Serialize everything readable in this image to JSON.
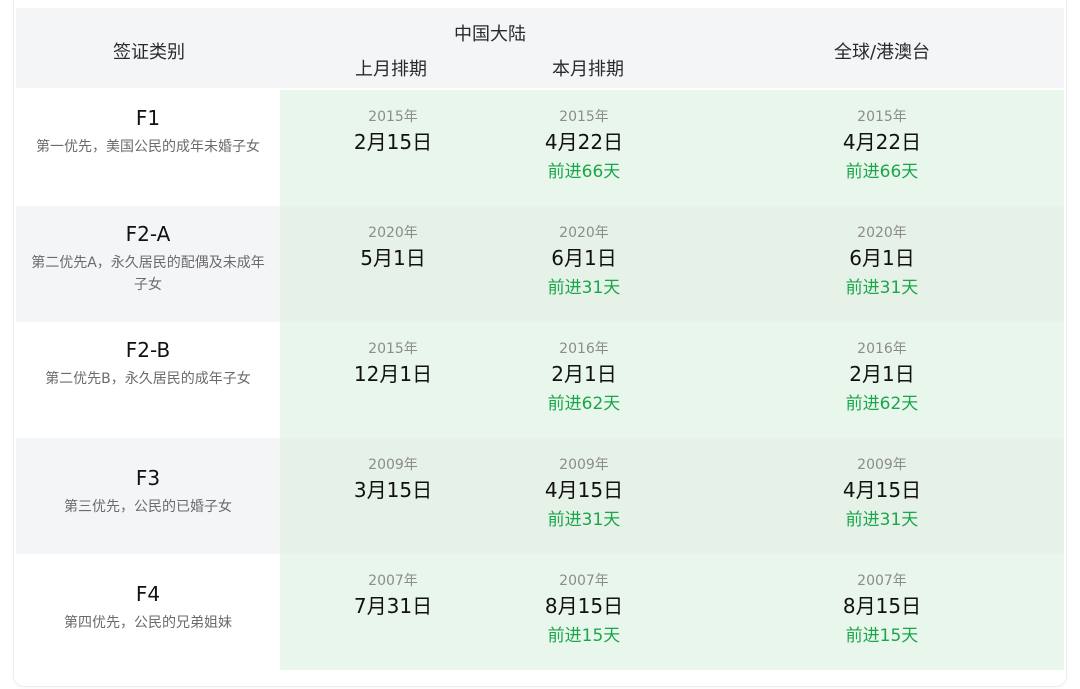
{
  "header": {
    "category": "签证类别",
    "mainland": "中国大陆",
    "last_month": "上月排期",
    "this_month": "本月排期",
    "global": "全球/港澳台"
  },
  "rows": [
    {
      "code": "F1",
      "desc": "第一优先，美国公民的成年未婚子女",
      "last": {
        "year": "2015年",
        "date": "2月15日"
      },
      "current": {
        "year": "2015年",
        "date": "4月22日",
        "advance": "前进66天"
      },
      "global": {
        "year": "2015年",
        "date": "4月22日",
        "advance": "前进66天"
      }
    },
    {
      "code": "F2-A",
      "desc": "第二优先A，永久居民的配偶及未成年子女",
      "last": {
        "year": "2020年",
        "date": "5月1日"
      },
      "current": {
        "year": "2020年",
        "date": "6月1日",
        "advance": "前进31天"
      },
      "global": {
        "year": "2020年",
        "date": "6月1日",
        "advance": "前进31天"
      }
    },
    {
      "code": "F2-B",
      "desc": "第二优先B，永久居民的成年子女",
      "last": {
        "year": "2015年",
        "date": "12月1日"
      },
      "current": {
        "year": "2016年",
        "date": "2月1日",
        "advance": "前进62天"
      },
      "global": {
        "year": "2016年",
        "date": "2月1日",
        "advance": "前进62天"
      }
    },
    {
      "code": "F3",
      "desc": "第三优先，公民的已婚子女",
      "last": {
        "year": "2009年",
        "date": "3月15日"
      },
      "current": {
        "year": "2009年",
        "date": "4月15日",
        "advance": "前进31天"
      },
      "global": {
        "year": "2009年",
        "date": "4月15日",
        "advance": "前进31天"
      }
    },
    {
      "code": "F4",
      "desc": "第四优先，公民的兄弟姐妹",
      "last": {
        "year": "2007年",
        "date": "7月31日"
      },
      "current": {
        "year": "2007年",
        "date": "8月15日",
        "advance": "前进15天"
      },
      "global": {
        "year": "2007年",
        "date": "8月15日",
        "advance": "前进15天"
      }
    }
  ],
  "colors": {
    "advance": "#1aa64a",
    "header_bg": "#f4f5f7",
    "data_bg": "#e9f6ec"
  }
}
